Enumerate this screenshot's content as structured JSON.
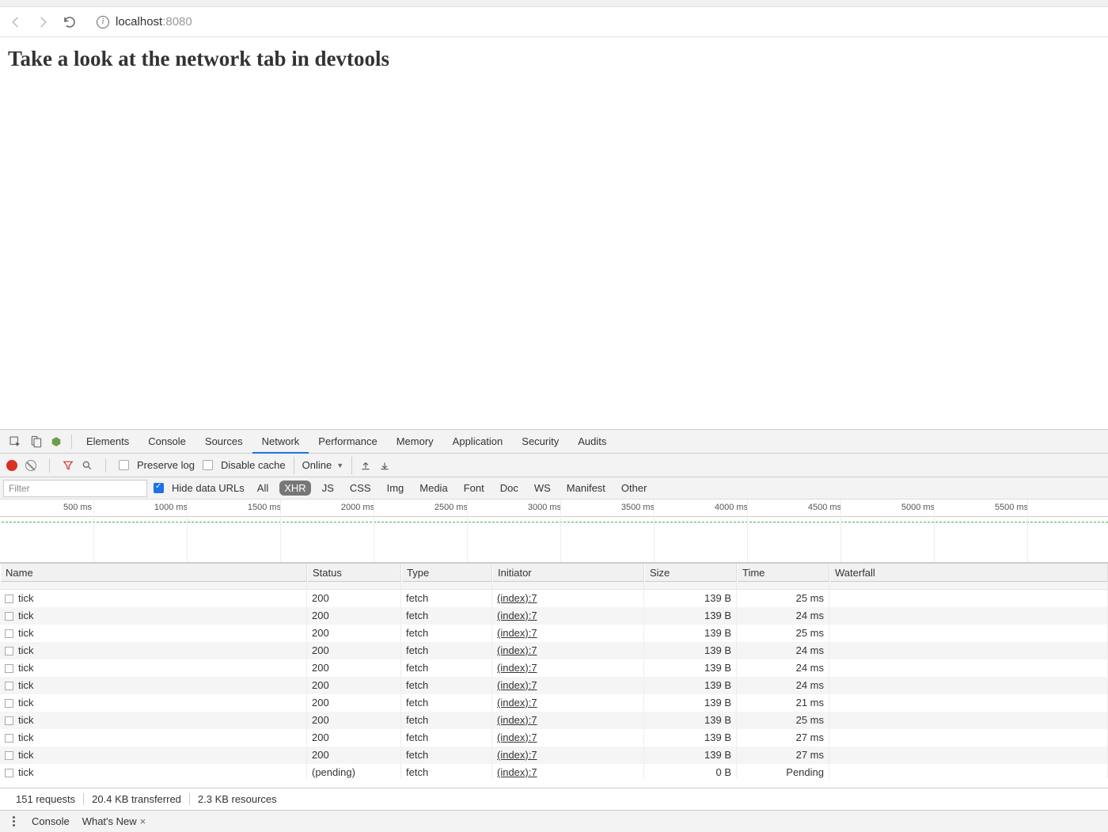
{
  "browser": {
    "url_host": "localhost",
    "url_port": ":8080"
  },
  "page": {
    "heading": "Take a look at the network tab in devtools"
  },
  "devtools": {
    "tabs": [
      "Elements",
      "Console",
      "Sources",
      "Network",
      "Performance",
      "Memory",
      "Application",
      "Security",
      "Audits"
    ],
    "active_tab": "Network",
    "toolbar": {
      "preserve_log": "Preserve log",
      "disable_cache": "Disable cache",
      "throttle": "Online"
    },
    "filter": {
      "placeholder": "Filter",
      "hide_data_urls": "Hide data URLs",
      "types": [
        "All",
        "XHR",
        "JS",
        "CSS",
        "Img",
        "Media",
        "Font",
        "Doc",
        "WS",
        "Manifest",
        "Other"
      ],
      "active_type": "XHR"
    },
    "timeline_ticks": [
      "500 ms",
      "1000 ms",
      "1500 ms",
      "2000 ms",
      "2500 ms",
      "3000 ms",
      "3500 ms",
      "4000 ms",
      "4500 ms",
      "5000 ms",
      "5500 ms"
    ],
    "columns": [
      "Name",
      "Status",
      "Type",
      "Initiator",
      "Size",
      "Time",
      "Waterfall"
    ],
    "rows": [
      {
        "name": "tick",
        "status": "200",
        "type": "fetch",
        "initiator": "(index):7",
        "size": "139 B",
        "time": "25 ms"
      },
      {
        "name": "tick",
        "status": "200",
        "type": "fetch",
        "initiator": "(index):7",
        "size": "139 B",
        "time": "24 ms"
      },
      {
        "name": "tick",
        "status": "200",
        "type": "fetch",
        "initiator": "(index):7",
        "size": "139 B",
        "time": "25 ms"
      },
      {
        "name": "tick",
        "status": "200",
        "type": "fetch",
        "initiator": "(index):7",
        "size": "139 B",
        "time": "24 ms"
      },
      {
        "name": "tick",
        "status": "200",
        "type": "fetch",
        "initiator": "(index):7",
        "size": "139 B",
        "time": "24 ms"
      },
      {
        "name": "tick",
        "status": "200",
        "type": "fetch",
        "initiator": "(index):7",
        "size": "139 B",
        "time": "24 ms"
      },
      {
        "name": "tick",
        "status": "200",
        "type": "fetch",
        "initiator": "(index):7",
        "size": "139 B",
        "time": "21 ms"
      },
      {
        "name": "tick",
        "status": "200",
        "type": "fetch",
        "initiator": "(index):7",
        "size": "139 B",
        "time": "25 ms"
      },
      {
        "name": "tick",
        "status": "200",
        "type": "fetch",
        "initiator": "(index):7",
        "size": "139 B",
        "time": "27 ms"
      },
      {
        "name": "tick",
        "status": "200",
        "type": "fetch",
        "initiator": "(index):7",
        "size": "139 B",
        "time": "27 ms"
      },
      {
        "name": "tick",
        "status": "(pending)",
        "type": "fetch",
        "initiator": "(index):7",
        "size": "0 B",
        "time": "Pending"
      }
    ],
    "status_bar": {
      "requests": "151 requests",
      "transferred": "20.4 KB transferred",
      "resources": "2.3 KB resources"
    },
    "drawer": {
      "console": "Console",
      "whatsnew": "What's New"
    }
  }
}
